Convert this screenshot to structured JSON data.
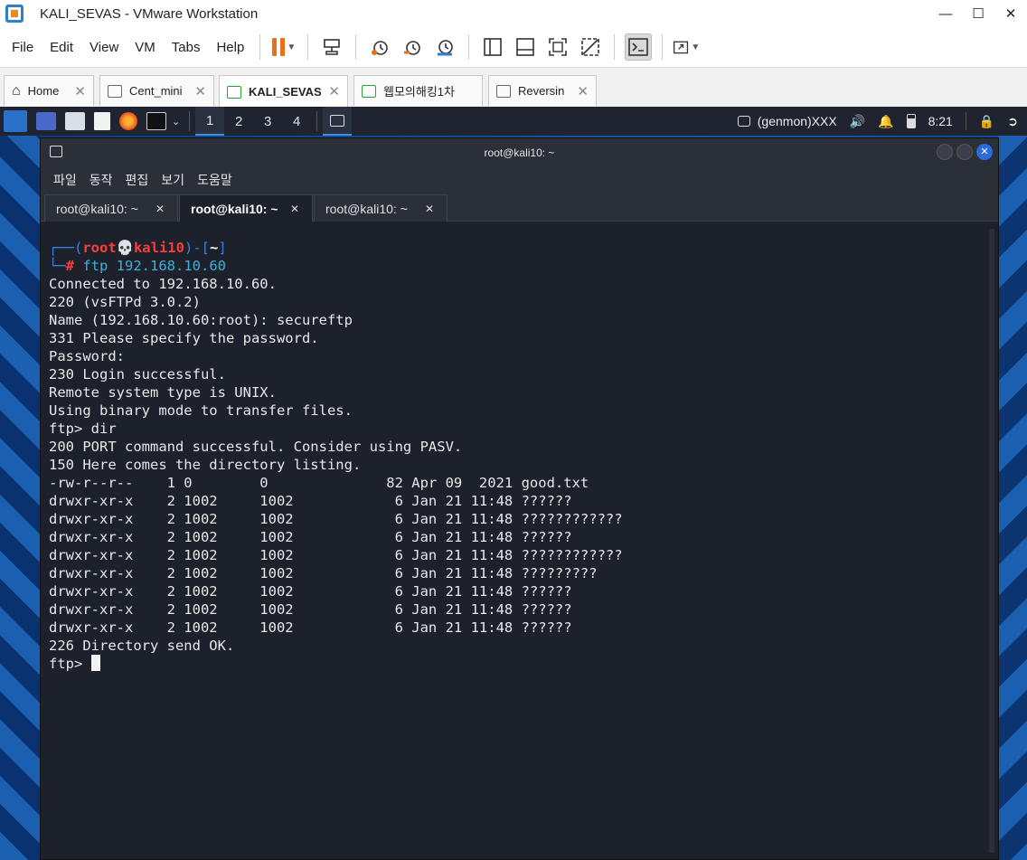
{
  "vmware": {
    "title": "KALI_SEVAS - VMware Workstation",
    "menu": [
      "File",
      "Edit",
      "View",
      "VM",
      "Tabs",
      "Help"
    ],
    "tabs": [
      {
        "label": "Home",
        "active": false
      },
      {
        "label": "Cent_mini",
        "active": false
      },
      {
        "label": "KALI_SEVAS",
        "active": true
      },
      {
        "label": "웹모의해킹1차",
        "active": false
      },
      {
        "label": "Reversin",
        "active": false
      }
    ]
  },
  "kali_panel": {
    "workspaces": [
      "1",
      "2",
      "3",
      "4"
    ],
    "active_workspace": "1",
    "genmon": "(genmon)XXX",
    "clock": "8:21"
  },
  "terminal": {
    "title": "root@kali10: ~",
    "menu": [
      "파일",
      "동작",
      "편집",
      "보기",
      "도움말"
    ],
    "tabs": [
      {
        "label": "root@kali10: ~",
        "active": false
      },
      {
        "label": "root@kali10: ~",
        "active": true
      },
      {
        "label": "root@kali10: ~",
        "active": false
      }
    ],
    "prompt": {
      "user": "root",
      "host": "kali10",
      "dir": "~",
      "command": "ftp 192.168.10.60"
    },
    "output": [
      "Connected to 192.168.10.60.",
      "220 (vsFTPd 3.0.2)",
      "Name (192.168.10.60:root): secureftp",
      "331 Please specify the password.",
      "Password:",
      "230 Login successful.",
      "Remote system type is UNIX.",
      "Using binary mode to transfer files.",
      "ftp> dir",
      "200 PORT command successful. Consider using PASV.",
      "150 Here comes the directory listing.",
      "-rw-r--r--    1 0        0              82 Apr 09  2021 good.txt",
      "drwxr-xr-x    2 1002     1002            6 Jan 21 11:48 ??????",
      "drwxr-xr-x    2 1002     1002            6 Jan 21 11:48 ????????????",
      "drwxr-xr-x    2 1002     1002            6 Jan 21 11:48 ??????",
      "drwxr-xr-x    2 1002     1002            6 Jan 21 11:48 ????????????",
      "drwxr-xr-x    2 1002     1002            6 Jan 21 11:48 ?????????",
      "drwxr-xr-x    2 1002     1002            6 Jan 21 11:48 ??????",
      "drwxr-xr-x    2 1002     1002            6 Jan 21 11:48 ??????",
      "drwxr-xr-x    2 1002     1002            6 Jan 21 11:48 ??????",
      "226 Directory send OK."
    ],
    "current_prompt": "ftp> "
  },
  "colors": {
    "terminal_bg": "#1d212b",
    "prompt_red": "#ff3b3b",
    "prompt_blue": "#3f7fe0",
    "accent_orange": "#e8701a"
  }
}
